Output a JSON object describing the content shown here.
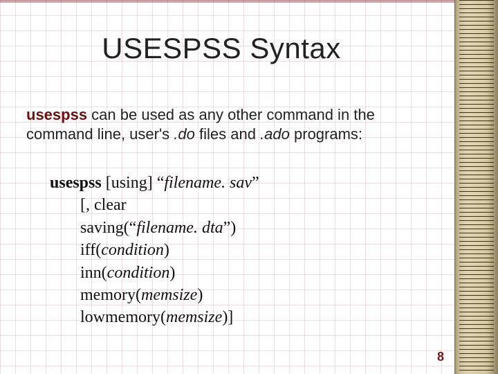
{
  "title": "USESPSS Syntax",
  "intro": {
    "cmd": "usespss",
    "part1": " can be used as any other command in the command line, user's ",
    "code1": ".do",
    "part2": " files and ",
    "code2": ".ado",
    "part3": " programs:"
  },
  "syntax_lines": [
    {
      "pre": "",
      "bold": "usespss ",
      "rest": "[using] “",
      "ital": "filename. sav",
      "post": "”"
    },
    {
      "pre": "indent",
      "bold": "",
      "rest": "[, clear",
      "ital": "",
      "post": ""
    },
    {
      "pre": "indent",
      "bold": "",
      "rest": "saving(“",
      "ital": "filename. dta",
      "post": "”)"
    },
    {
      "pre": "indent",
      "bold": "",
      "rest": "iff(",
      "ital": "condition",
      "post": ")"
    },
    {
      "pre": "indent",
      "bold": "",
      "rest": "inn(",
      "ital": "condition",
      "post": ")"
    },
    {
      "pre": "indent",
      "bold": "",
      "rest": "memory(",
      "ital": "memsize",
      "post": ")"
    },
    {
      "pre": "indent",
      "bold": "",
      "rest": "lowmemory(",
      "ital": "memsize",
      "post": ")]"
    }
  ],
  "page_number": "8"
}
